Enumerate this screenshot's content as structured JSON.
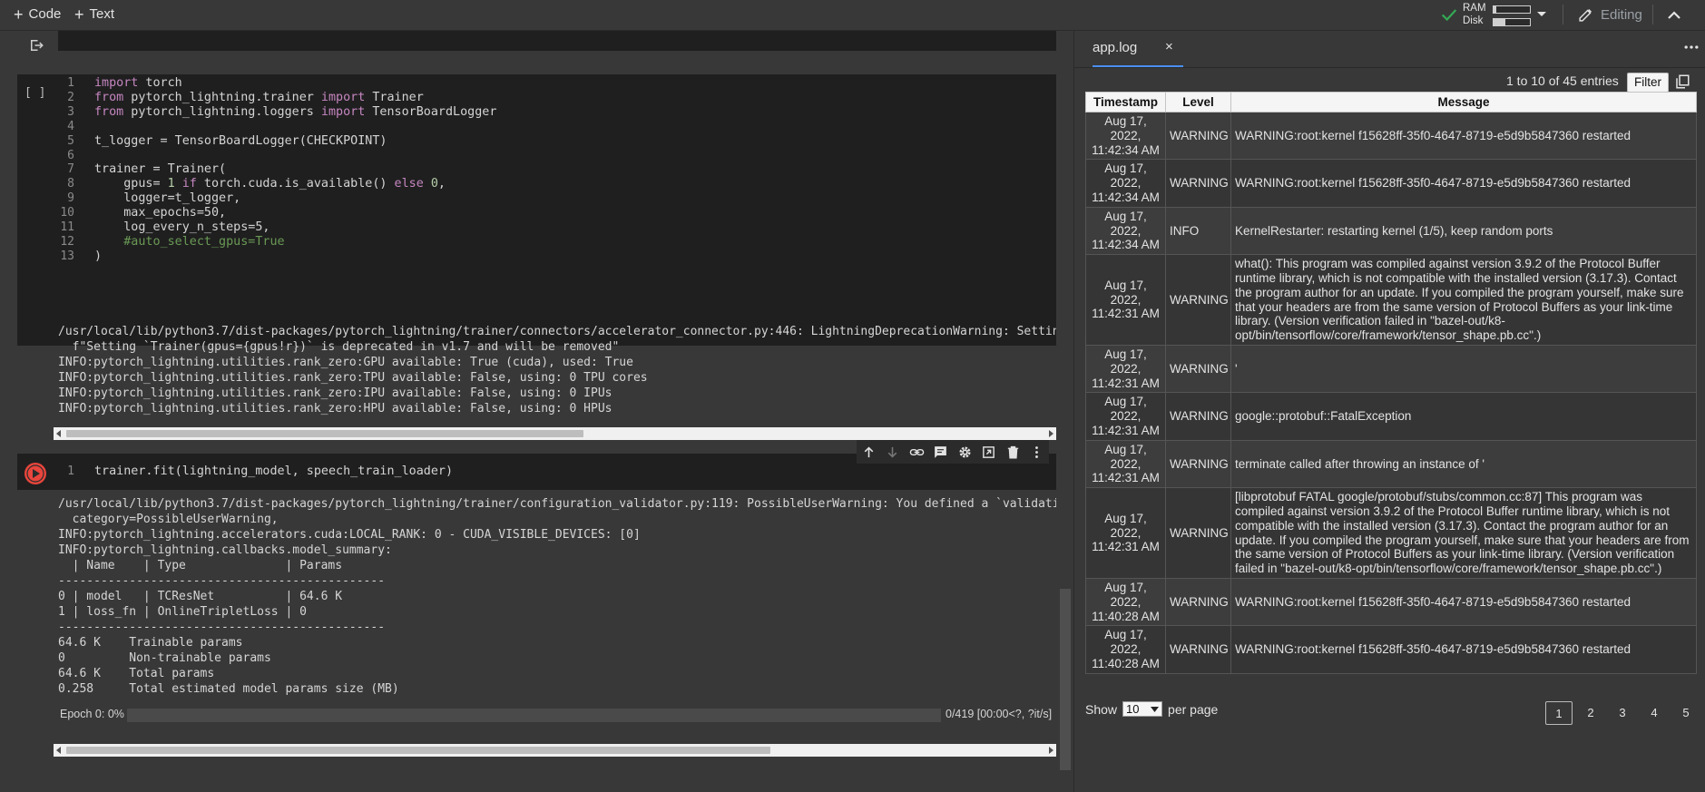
{
  "toolbar": {
    "code_label": "Code",
    "text_label": "Text",
    "ram_label": "RAM",
    "disk_label": "Disk",
    "ram_fraction": 0.08,
    "disk_fraction": 0.33,
    "editing_label": "Editing"
  },
  "cell1": {
    "run_indicator": "[ ]",
    "lines": [
      {
        "n": "1",
        "code": "import torch"
      },
      {
        "n": "2",
        "code": "from pytorch_lightning.trainer import Trainer"
      },
      {
        "n": "3",
        "code": "from pytorch_lightning.loggers import TensorBoardLogger"
      },
      {
        "n": "4",
        "code": ""
      },
      {
        "n": "5",
        "code": "t_logger = TensorBoardLogger(CHECKPOINT)"
      },
      {
        "n": "6",
        "code": ""
      },
      {
        "n": "7",
        "code": "trainer = Trainer("
      },
      {
        "n": "8",
        "code": "    gpus= 1 if torch.cuda.is_available() else 0,"
      },
      {
        "n": "9",
        "code": "    logger=t_logger,"
      },
      {
        "n": "10",
        "code": "    max_epochs=50,"
      },
      {
        "n": "11",
        "code": "    log_every_n_steps=5,"
      },
      {
        "n": "12",
        "code": "    #auto_select_gpus=True"
      },
      {
        "n": "13",
        "code": ")"
      }
    ],
    "output": "/usr/local/lib/python3.7/dist-packages/pytorch_lightning/trainer/connectors/accelerator_connector.py:446: LightningDeprecationWarning: Setting\n  f\"Setting `Trainer(gpus={gpus!r})` is deprecated in v1.7 and will be removed\"\nINFO:pytorch_lightning.utilities.rank_zero:GPU available: True (cuda), used: True\nINFO:pytorch_lightning.utilities.rank_zero:TPU available: False, using: 0 TPU cores\nINFO:pytorch_lightning.utilities.rank_zero:IPU available: False, using: 0 IPUs\nINFO:pytorch_lightning.utilities.rank_zero:HPU available: False, using: 0 HPUs"
  },
  "cell2": {
    "line_number": "1",
    "code": "trainer.fit(lightning_model, speech_train_loader)",
    "output": "/usr/local/lib/python3.7/dist-packages/pytorch_lightning/trainer/configuration_validator.py:119: PossibleUserWarning: You defined a `validation\n  category=PossibleUserWarning,\nINFO:pytorch_lightning.accelerators.cuda:LOCAL_RANK: 0 - CUDA_VISIBLE_DEVICES: [0]\nINFO:pytorch_lightning.callbacks.model_summary:\n  | Name    | Type              | Params\n----------------------------------------------\n0 | model   | TCResNet          | 64.6 K\n1 | loss_fn | OnlineTripletLoss | 0\n----------------------------------------------\n64.6 K    Trainable params\n0         Non-trainable params\n64.6 K    Total params\n0.258     Total estimated model params size (MB)",
    "progress_label": "Epoch 0: 0%",
    "progress_fraction": 0,
    "progress_stats": "0/419 [00:00<?, ?it/s]"
  },
  "panel": {
    "tab_name": "app.log",
    "tab_close": "×",
    "entries_text": "1 to 10 of 45 entries",
    "filter_label": "Filter",
    "columns": [
      "Timestamp",
      "Level",
      "Message"
    ],
    "rows": [
      {
        "ts": "Aug 17, 2022, 11:42:34 AM",
        "level": "WARNING",
        "msg": "WARNING:root:kernel f15628ff-35f0-4647-8719-e5d9b5847360 restarted"
      },
      {
        "ts": "Aug 17, 2022, 11:42:34 AM",
        "level": "WARNING",
        "msg": "WARNING:root:kernel f15628ff-35f0-4647-8719-e5d9b5847360 restarted"
      },
      {
        "ts": "Aug 17, 2022, 11:42:34 AM",
        "level": "INFO",
        "msg": "KernelRestarter: restarting kernel (1/5), keep random ports"
      },
      {
        "ts": "Aug 17, 2022, 11:42:31 AM",
        "level": "WARNING",
        "msg": "what(): This program was compiled against version 3.9.2 of the Protocol Buffer runtime library, which is not compatible with the installed version (3.17.3). Contact the program author for an update. If you compiled the program yourself, make sure that your headers are from the same version of Protocol Buffers as your link-time library. (Version verification failed in \"bazel-out/k8-opt/bin/tensorflow/core/framework/tensor_shape.pb.cc\".)"
      },
      {
        "ts": "Aug 17, 2022, 11:42:31 AM",
        "level": "WARNING",
        "msg": "'"
      },
      {
        "ts": "Aug 17, 2022, 11:42:31 AM",
        "level": "WARNING",
        "msg": "google::protobuf::FatalException"
      },
      {
        "ts": "Aug 17, 2022, 11:42:31 AM",
        "level": "WARNING",
        "msg": "terminate called after throwing an instance of '"
      },
      {
        "ts": "Aug 17, 2022, 11:42:31 AM",
        "level": "WARNING",
        "msg": "[libprotobuf FATAL google/protobuf/stubs/common.cc:87] This program was compiled against version 3.9.2 of the Protocol Buffer runtime library, which is not compatible with the installed version (3.17.3). Contact the program author for an update. If you compiled the program yourself, make sure that your headers are from the same version of Protocol Buffers as your link-time library. (Version verification failed in \"bazel-out/k8-opt/bin/tensorflow/core/framework/tensor_shape.pb.cc\".)"
      },
      {
        "ts": "Aug 17, 2022, 11:40:28 AM",
        "level": "WARNING",
        "msg": "WARNING:root:kernel f15628ff-35f0-4647-8719-e5d9b5847360 restarted"
      },
      {
        "ts": "Aug 17, 2022, 11:40:28 AM",
        "level": "WARNING",
        "msg": "WARNING:root:kernel f15628ff-35f0-4647-8719-e5d9b5847360 restarted"
      }
    ],
    "show_label": "Show",
    "page_size": "10",
    "per_page_label": "per page",
    "pages": [
      "1",
      "2",
      "3",
      "4",
      "5"
    ],
    "active_page": "1"
  },
  "colors": {
    "background": "#383838",
    "editor_bg": "#1f1f1f",
    "accent": "#4a8ff3",
    "ok_green": "#34a853",
    "run_red": "#e8453c"
  },
  "icons": [
    "check-icon",
    "pencil-icon",
    "chevron-up-icon",
    "cell-output-icon",
    "run-icon",
    "arrow-up-icon",
    "arrow-down-icon",
    "link-icon",
    "comment-icon",
    "gear-icon",
    "mirror-cell-icon",
    "trash-icon",
    "more-vert-icon",
    "copy-icon"
  ]
}
